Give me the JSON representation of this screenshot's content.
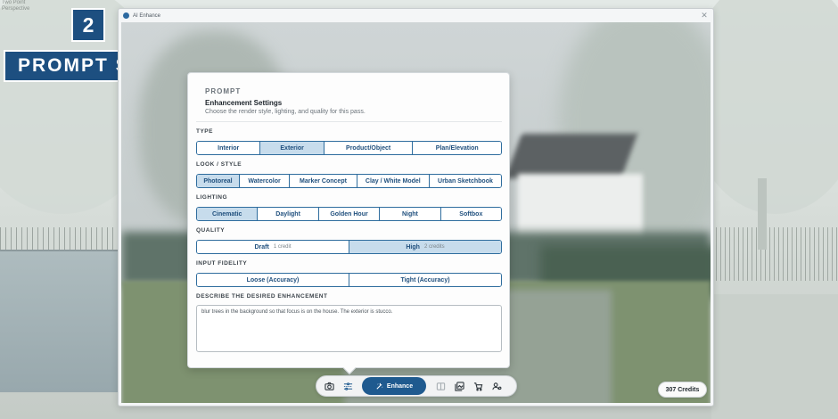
{
  "corner_caption": [
    "Two Point",
    "Perspective"
  ],
  "step": {
    "number": "2",
    "title": "PROMPT SETTINGS"
  },
  "window": {
    "title": "AI Enhance"
  },
  "panel": {
    "kicker": "PROMPT",
    "title": "Enhancement Settings",
    "subtitle": "Choose the render style, lighting, and quality for this pass.",
    "type": {
      "label": "TYPE",
      "options": [
        "Interior",
        "Exterior",
        "Product/Object",
        "Plan/Elevation"
      ],
      "selected": "Exterior"
    },
    "look": {
      "label": "LOOK / STYLE",
      "options": [
        "Photoreal",
        "Watercolor",
        "Marker Concept",
        "Clay / White Model",
        "Urban Sketchbook"
      ],
      "selected": "Photoreal"
    },
    "lighting": {
      "label": "LIGHTING",
      "options": [
        "Cinematic",
        "Daylight",
        "Golden Hour",
        "Night",
        "Softbox"
      ],
      "selected": "Cinematic"
    },
    "quality": {
      "label": "QUALITY",
      "options": [
        {
          "label": "Draft",
          "cost": "1 credit"
        },
        {
          "label": "High",
          "cost": "2 credits"
        }
      ],
      "selected": "High"
    },
    "fidelity": {
      "label": "INPUT FIDELITY",
      "options": [
        "Loose (Accuracy)",
        "Tight (Accuracy)"
      ]
    },
    "prompt": {
      "label": "DESCRIBE THE DESIRED ENHANCEMENT",
      "value": "blur trees in the background so that focus is on the house. The exterior is stucco."
    }
  },
  "toolbar": {
    "icons": [
      "camera-icon",
      "prompt-settings-icon",
      "enhance-icon",
      "compare-icon",
      "gallery-icon",
      "cart-icon",
      "account-icon"
    ],
    "enhance_label": "Enhance"
  },
  "credits": "307 Credits",
  "colors": {
    "brand": "#1d4f80",
    "accent": "#2f6d9e",
    "selected": "#c7dcec"
  }
}
